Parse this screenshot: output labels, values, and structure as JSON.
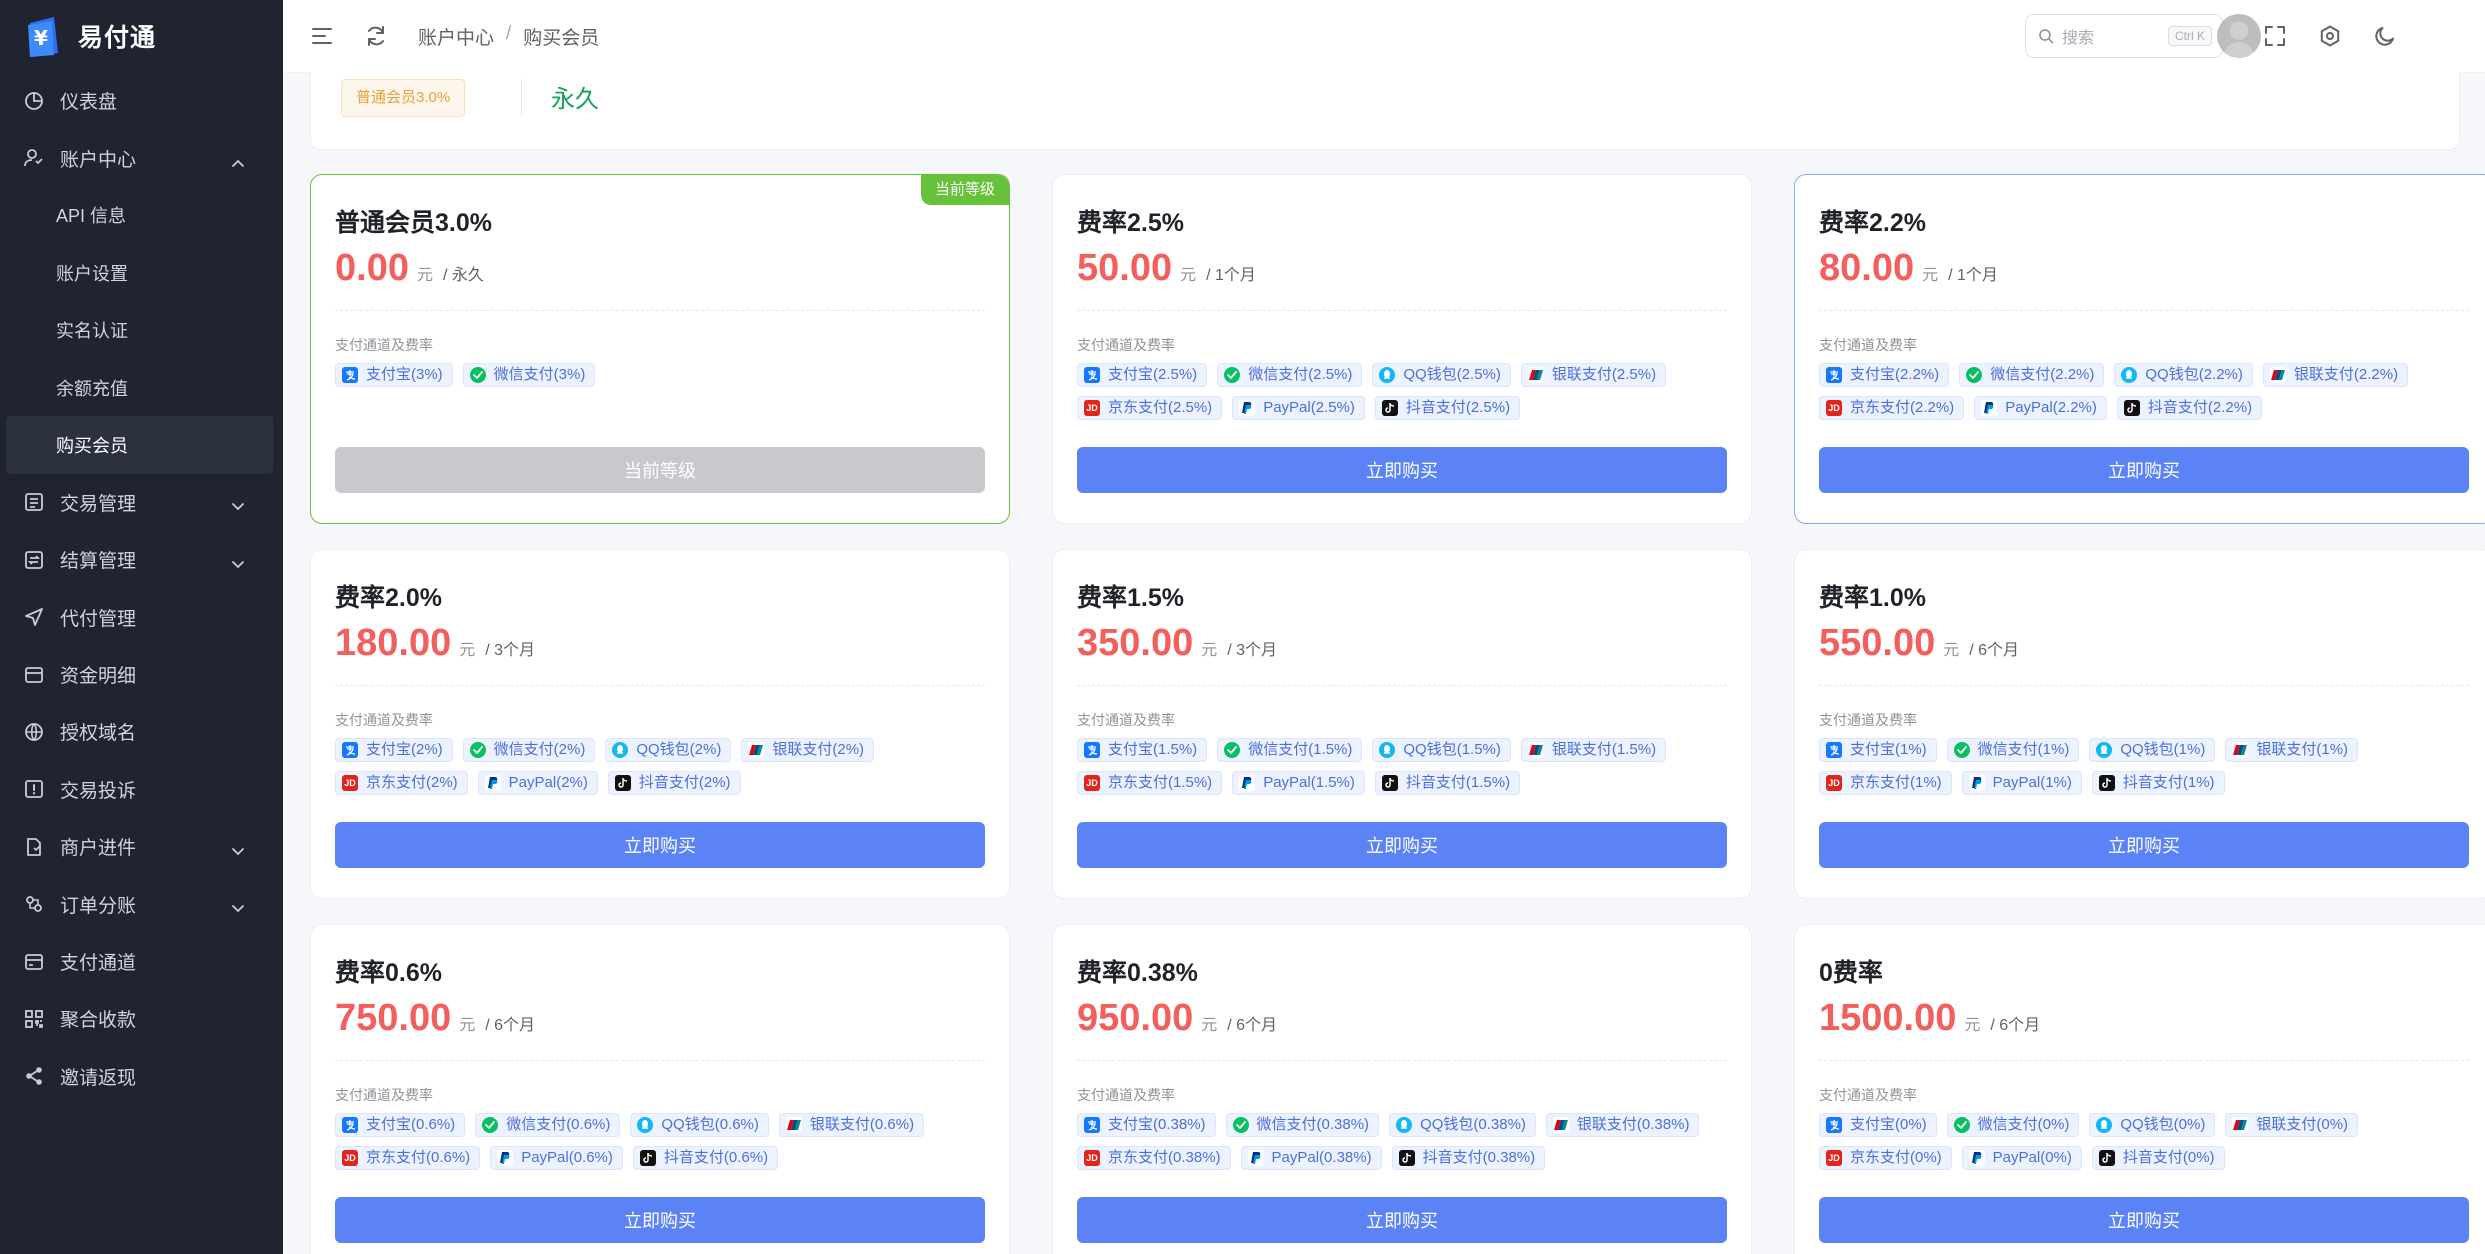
{
  "app": {
    "name": "易付通"
  },
  "sidebar": {
    "items": [
      {
        "label": "仪表盘",
        "icon": "dashboard-icon"
      },
      {
        "label": "账户中心",
        "icon": "user-icon",
        "expanded": true,
        "children": [
          "API 信息",
          "账户设置",
          "实名认证",
          "余额充值",
          "购买会员"
        ]
      },
      {
        "label": "交易管理",
        "icon": "list-icon",
        "chevron": true
      },
      {
        "label": "结算管理",
        "icon": "settle-icon",
        "chevron": true
      },
      {
        "label": "代付管理",
        "icon": "send-icon"
      },
      {
        "label": "资金明细",
        "icon": "card-icon"
      },
      {
        "label": "授权域名",
        "icon": "globe-icon"
      },
      {
        "label": "交易投诉",
        "icon": "alert-icon"
      },
      {
        "label": "商户进件",
        "icon": "doc-icon",
        "chevron": true
      },
      {
        "label": "订单分账",
        "icon": "split-icon",
        "chevron": true
      },
      {
        "label": "支付通道",
        "icon": "channel-icon"
      },
      {
        "label": "聚合收款",
        "icon": "qr-icon"
      },
      {
        "label": "邀请返现",
        "icon": "share-icon"
      }
    ],
    "active_child": "购买会员"
  },
  "header": {
    "breadcrumb": [
      "账户中心",
      "购买会员"
    ],
    "search_placeholder": "搜索",
    "search_shortcut": "Ctrl K"
  },
  "current_plan": {
    "tag": "普通会员3.0%",
    "validity": "永久"
  },
  "common": {
    "channel_label": "支付通道及费率",
    "unit": "元",
    "buy_label": "立即购买",
    "current_label": "当前等级",
    "ribbon": "当前等级"
  },
  "colors": {
    "accent": "#5b83f5",
    "price": "#f25f5c",
    "current": "#67c23a",
    "validity": "#18a058"
  },
  "plans": [
    {
      "title": "普通会员3.0%",
      "price": "0.00",
      "period": "/ 永久",
      "current": true,
      "channels": [
        [
          "alipay",
          "支付宝(3%)"
        ],
        [
          "wechat",
          "微信支付(3%)"
        ]
      ]
    },
    {
      "title": "费率2.5%",
      "price": "50.00",
      "period": "/ 1个月",
      "channels": [
        [
          "alipay",
          "支付宝(2.5%)"
        ],
        [
          "wechat",
          "微信支付(2.5%)"
        ],
        [
          "qq",
          "QQ钱包(2.5%)"
        ],
        [
          "union",
          "银联支付(2.5%)"
        ],
        [
          "jd",
          "京东支付(2.5%)"
        ],
        [
          "paypal",
          "PayPal(2.5%)"
        ],
        [
          "douyin",
          "抖音支付(2.5%)"
        ]
      ]
    },
    {
      "title": "费率2.2%",
      "price": "80.00",
      "period": "/ 1个月",
      "highlight": true,
      "channels": [
        [
          "alipay",
          "支付宝(2.2%)"
        ],
        [
          "wechat",
          "微信支付(2.2%)"
        ],
        [
          "qq",
          "QQ钱包(2.2%)"
        ],
        [
          "union",
          "银联支付(2.2%)"
        ],
        [
          "jd",
          "京东支付(2.2%)"
        ],
        [
          "paypal",
          "PayPal(2.2%)"
        ],
        [
          "douyin",
          "抖音支付(2.2%)"
        ]
      ]
    },
    {
      "title": "费率2.0%",
      "price": "180.00",
      "period": "/ 3个月",
      "channels": [
        [
          "alipay",
          "支付宝(2%)"
        ],
        [
          "wechat",
          "微信支付(2%)"
        ],
        [
          "qq",
          "QQ钱包(2%)"
        ],
        [
          "union",
          "银联支付(2%)"
        ],
        [
          "jd",
          "京东支付(2%)"
        ],
        [
          "paypal",
          "PayPal(2%)"
        ],
        [
          "douyin",
          "抖音支付(2%)"
        ]
      ]
    },
    {
      "title": "费率1.5%",
      "price": "350.00",
      "period": "/ 3个月",
      "channels": [
        [
          "alipay",
          "支付宝(1.5%)"
        ],
        [
          "wechat",
          "微信支付(1.5%)"
        ],
        [
          "qq",
          "QQ钱包(1.5%)"
        ],
        [
          "union",
          "银联支付(1.5%)"
        ],
        [
          "jd",
          "京东支付(1.5%)"
        ],
        [
          "paypal",
          "PayPal(1.5%)"
        ],
        [
          "douyin",
          "抖音支付(1.5%)"
        ]
      ]
    },
    {
      "title": "费率1.0%",
      "price": "550.00",
      "period": "/ 6个月",
      "channels": [
        [
          "alipay",
          "支付宝(1%)"
        ],
        [
          "wechat",
          "微信支付(1%)"
        ],
        [
          "qq",
          "QQ钱包(1%)"
        ],
        [
          "union",
          "银联支付(1%)"
        ],
        [
          "jd",
          "京东支付(1%)"
        ],
        [
          "paypal",
          "PayPal(1%)"
        ],
        [
          "douyin",
          "抖音支付(1%)"
        ]
      ]
    },
    {
      "title": "费率0.6%",
      "price": "750.00",
      "period": "/ 6个月",
      "channels": [
        [
          "alipay",
          "支付宝(0.6%)"
        ],
        [
          "wechat",
          "微信支付(0.6%)"
        ],
        [
          "qq",
          "QQ钱包(0.6%)"
        ],
        [
          "union",
          "银联支付(0.6%)"
        ],
        [
          "jd",
          "京东支付(0.6%)"
        ],
        [
          "paypal",
          "PayPal(0.6%)"
        ],
        [
          "douyin",
          "抖音支付(0.6%)"
        ]
      ]
    },
    {
      "title": "费率0.38%",
      "price": "950.00",
      "period": "/ 6个月",
      "channels": [
        [
          "alipay",
          "支付宝(0.38%)"
        ],
        [
          "wechat",
          "微信支付(0.38%)"
        ],
        [
          "qq",
          "QQ钱包(0.38%)"
        ],
        [
          "union",
          "银联支付(0.38%)"
        ],
        [
          "jd",
          "京东支付(0.38%)"
        ],
        [
          "paypal",
          "PayPal(0.38%)"
        ],
        [
          "douyin",
          "抖音支付(0.38%)"
        ]
      ]
    },
    {
      "title": "0费率",
      "price": "1500.00",
      "period": "/ 6个月",
      "channels": [
        [
          "alipay",
          "支付宝(0%)"
        ],
        [
          "wechat",
          "微信支付(0%)"
        ],
        [
          "qq",
          "QQ钱包(0%)"
        ],
        [
          "union",
          "银联支付(0%)"
        ],
        [
          "jd",
          "京东支付(0%)"
        ],
        [
          "paypal",
          "PayPal(0%)"
        ],
        [
          "douyin",
          "抖音支付(0%)"
        ]
      ]
    }
  ]
}
